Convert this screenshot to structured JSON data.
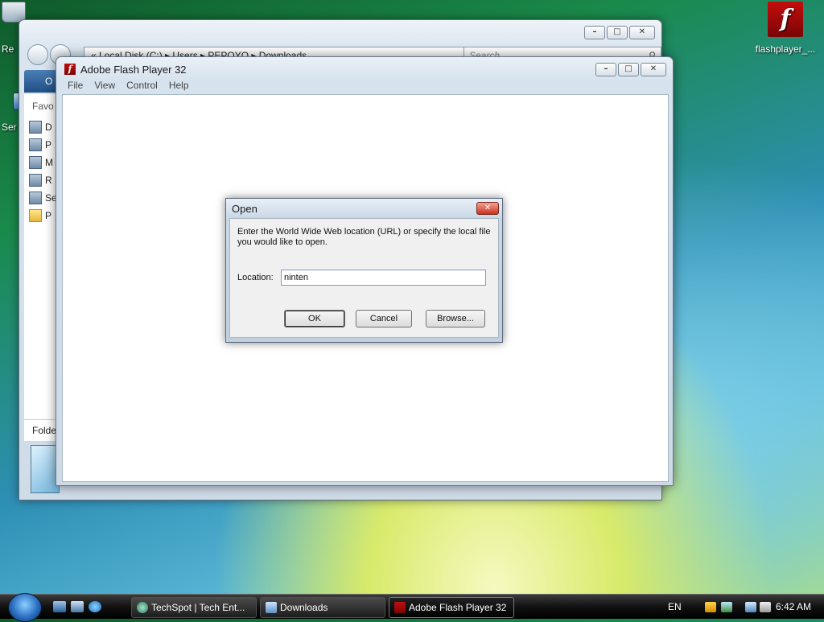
{
  "desktop": {
    "icons": [
      {
        "label": "flashplayer_..."
      },
      {
        "label": "Re"
      },
      {
        "label": "Ser"
      }
    ]
  },
  "explorer": {
    "address": "« Local Disk (C:) ▸ Users ▸ PEPOYO ▸ Downloads",
    "search_placeholder": "Search",
    "organize": "O",
    "favorites_header": "Favo",
    "nav_items": [
      "D",
      "P",
      "M",
      "R",
      "Se",
      "P"
    ],
    "folders_label": "Folde"
  },
  "flash": {
    "title": "Adobe Flash Player 32",
    "menu": [
      "File",
      "View",
      "Control",
      "Help"
    ]
  },
  "dialog": {
    "title": "Open",
    "message": "Enter the World Wide Web location (URL) or specify the local file you would like to open.",
    "location_label": "Location:",
    "location_value": "ninten",
    "ok": "OK",
    "cancel": "Cancel",
    "browse": "Browse..."
  },
  "taskbar": {
    "tasks": [
      {
        "label": "TechSpot | Tech Ent..."
      },
      {
        "label": "Downloads"
      },
      {
        "label": "Adobe Flash Player 32"
      }
    ],
    "language": "EN",
    "clock": "6:42 AM"
  },
  "colors": {
    "flash_red": "#c40d0d",
    "taskbar": "#111111",
    "dialog_close": "#c8321f"
  }
}
